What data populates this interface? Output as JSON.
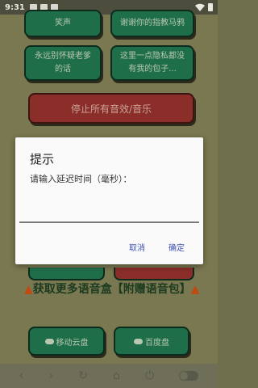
{
  "status_bar": {
    "time": "9:31"
  },
  "sound_buttons": [
    {
      "label": "笑声"
    },
    {
      "label": "谢谢你的指教马鸦"
    },
    {
      "label": "永远别怀疑老爹的话"
    },
    {
      "label": "这里一点隐私都没有我的包子..."
    }
  ],
  "stop_button": {
    "label": "停止所有音效/音乐"
  },
  "promo": {
    "text": "获取更多语音盒【附赠语音包】"
  },
  "cloud_buttons": [
    {
      "label": "移动云盘"
    },
    {
      "label": "百度盘"
    }
  ],
  "dialog": {
    "title": "提示",
    "message": "请输入延迟时间（毫秒）：",
    "input_value": "",
    "cancel_label": "取消",
    "ok_label": "确定"
  },
  "colors": {
    "sound_button_bg": "#1f6e4a",
    "stop_button_bg": "#8b2d28",
    "dialog_accent": "#3f51b5",
    "page_bg": "#7a7850"
  }
}
